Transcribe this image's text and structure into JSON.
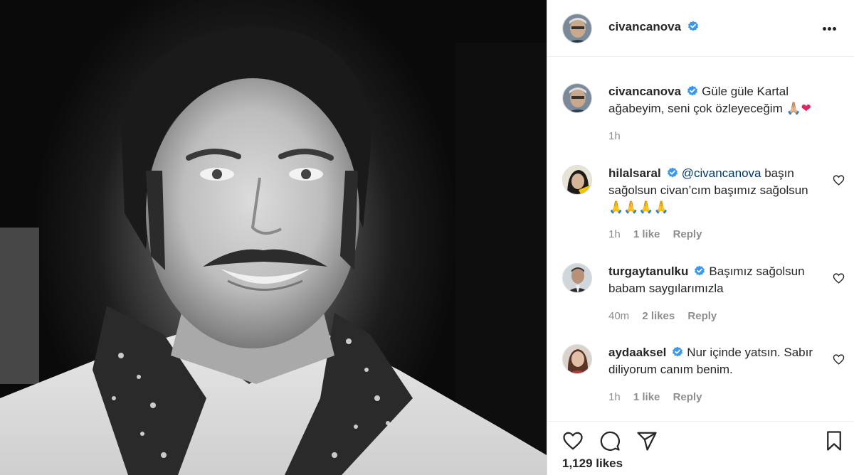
{
  "post": {
    "author": "civancanova",
    "verified": true,
    "caption_text": "Güle güle Kartal ağabeyim, seni çok özleyeceğim",
    "caption_emoji_pray": "🙏🏼",
    "caption_emoji_heart": "❤",
    "time": "1h"
  },
  "comments": [
    {
      "username": "hilalsaral",
      "mention": "@civancanova",
      "text": "başın sağolsun civan’cım başımız sağolsun",
      "emoji": "🙏🙏🙏🙏",
      "time": "1h",
      "likes": "1 like",
      "reply": "Reply"
    },
    {
      "username": "turgaytanulku",
      "text": "Başımız sağolsun babam saygılarımızla",
      "time": "40m",
      "likes": "2 likes",
      "reply": "Reply"
    },
    {
      "username": "aydaaksel",
      "text": "Nur içinde yatsın. Sabır diliyorum canım benim.",
      "time": "1h",
      "likes": "1 like",
      "reply": "Reply"
    }
  ],
  "footer": {
    "likes": "1,129 likes"
  },
  "icons": {
    "more": "more-options-icon",
    "verified": "verified-badge-icon",
    "like": "heart-icon",
    "comment": "comment-icon",
    "share": "share-icon",
    "save": "bookmark-icon"
  },
  "colors": {
    "verified_blue": "#3897f0",
    "meta_gray": "#8e8e8e",
    "mention_blue": "#00376b"
  }
}
